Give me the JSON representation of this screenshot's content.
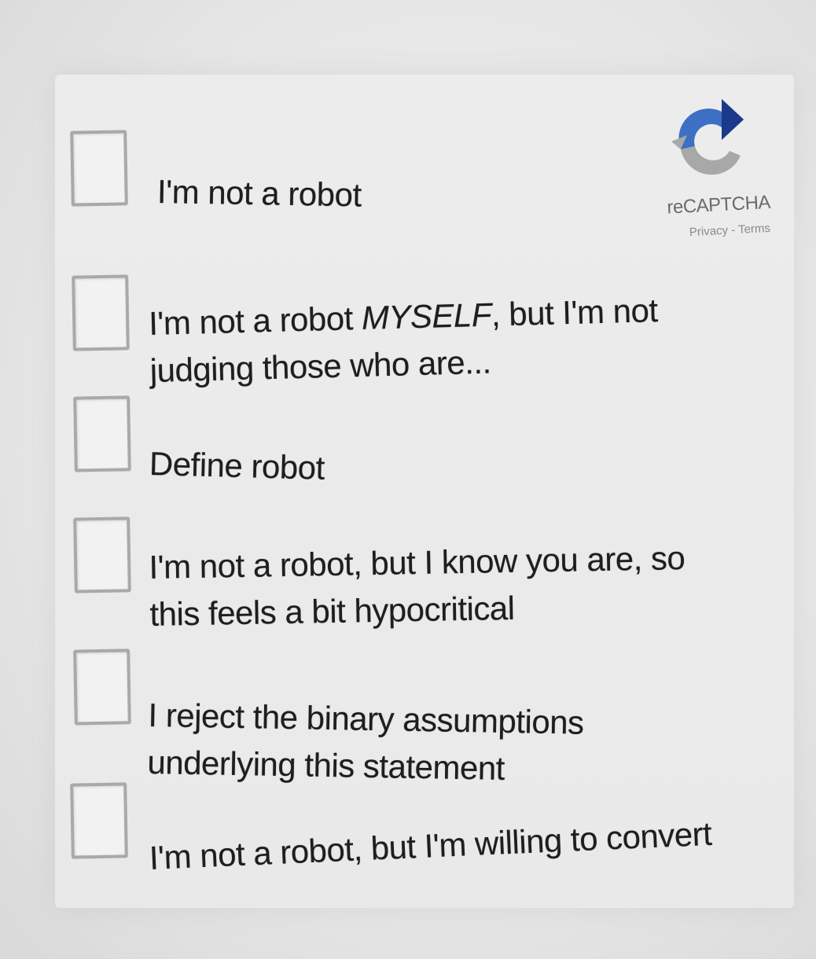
{
  "recaptcha": {
    "brand": "reCAPTCHA",
    "privacy_link": "Privacy",
    "separator": " - ",
    "terms_link": "Terms",
    "colors": {
      "blue": "#3d6fc4",
      "dark_blue": "#1c3a8a",
      "gray": "#a8a8a8"
    }
  },
  "options": [
    {
      "line1_before": "I'm not a robot",
      "line1_em": "",
      "line1_after": "",
      "line2": "",
      "checked": false
    },
    {
      "line1_before": "I'm not a robot ",
      "line1_em": "MYSELF",
      "line1_after": ", but I'm not",
      "line2": "judging those who are...",
      "checked": false
    },
    {
      "line1_before": "Define robot",
      "line1_em": "",
      "line1_after": "",
      "line2": "",
      "checked": false
    },
    {
      "line1_before": "I'm not a robot, but I know you are, so",
      "line1_em": "",
      "line1_after": "",
      "line2": "this feels a bit hypocritical",
      "checked": false
    },
    {
      "line1_before": "I reject the binary assumptions",
      "line1_em": "",
      "line1_after": "",
      "line2": "underlying this statement",
      "checked": false
    },
    {
      "line1_before": "I'm not a robot, but I'm willing to convert",
      "line1_em": "",
      "line1_after": "",
      "line2": "",
      "checked": false
    }
  ]
}
